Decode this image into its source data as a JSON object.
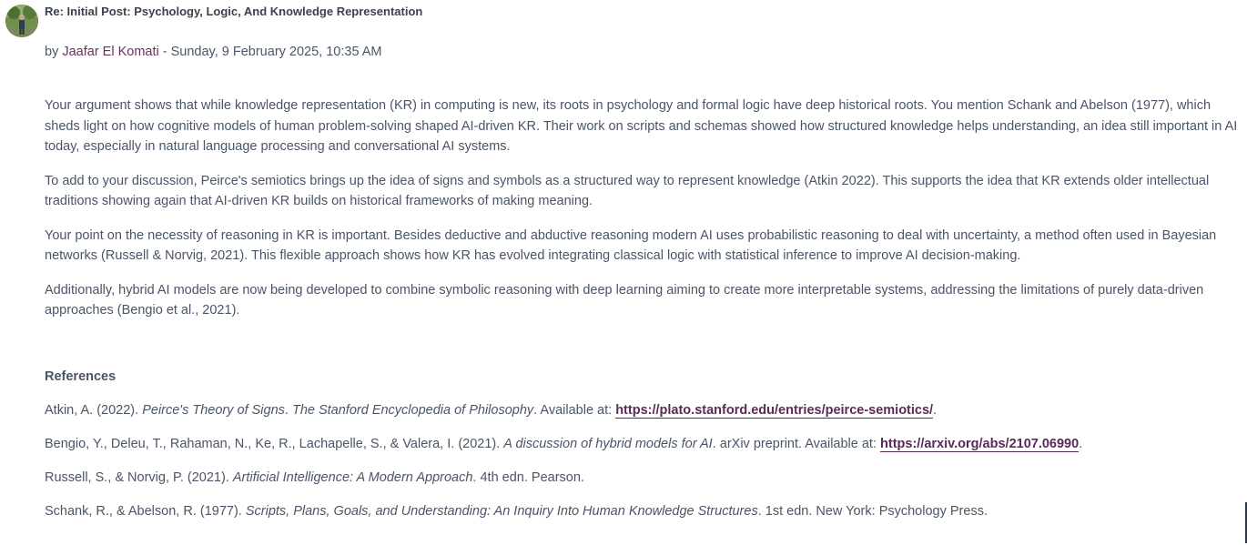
{
  "post": {
    "subject": "Re: Initial Post: Psychology, Logic, And Knowledge Representation",
    "by_prefix": "by ",
    "author": "Jaafar El Komati",
    "date": " - Sunday, 9 February 2025, 10:35 AM",
    "paragraphs": [
      "Your argument shows that while knowledge representation (KR) in computing is new, its roots in psychology and formal logic have deep historical roots. You mention Schank and Abelson (1977), which sheds light on how cognitive models of human problem-solving shaped AI-driven KR. Their work on scripts and schemas showed how structured knowledge helps understanding, an idea still important in AI today, especially in natural language processing and conversational AI systems.",
      "To add to your discussion, Peirce's semiotics brings up the idea of signs and symbols as a structured way to represent knowledge (Atkin 2022). This supports the idea that KR extends older intellectual traditions showing again that AI-driven KR builds on historical frameworks of making meaning.",
      "Your point on the necessity of reasoning in KR is important. Besides deductive and abductive reasoning modern AI uses probabilistic reasoning to deal with uncertainty, a method often used in Bayesian networks (Russell & Norvig, 2021). This flexible approach shows how KR has evolved integrating classical logic with statistical inference to improve AI decision-making.",
      "Additionally, hybrid AI models are now being developed to combine symbolic reasoning with deep learning aiming to create more interpretable systems, addressing the limitations of purely data-driven approaches (Bengio et al., 2021)."
    ],
    "references_heading": "References",
    "references": [
      {
        "before": "Atkin, A. (2022). ",
        "title": "Peirce's Theory of Signs",
        "mid": ". ",
        "source": "The Stanford Encyclopedia of Philosophy",
        "after": ". Available at: ",
        "link": "https://plato.stanford.edu/entries/peirce-semiotics/",
        "end": "."
      },
      {
        "before": "Bengio, Y., Deleu, T., Rahaman, N., Ke, R., Lachapelle, S., & Valera, I. (2021). ",
        "title": "A discussion of hybrid models for AI",
        "after": ". arXiv preprint. Available at: ",
        "link": "https://arxiv.org/abs/2107.06990",
        "end": "."
      },
      {
        "before": "Russell, S., & Norvig, P. (2021). ",
        "title": "Artificial Intelligence: A Modern Approach",
        "after": ". 4th edn. Pearson."
      },
      {
        "before": "Schank, R., & Abelson, R. (1977). ",
        "title": "Scripts, Plans, Goals, and Understanding: An Inquiry Into Human Knowledge Structures",
        "after": ". 1st edn. New York: Psychology Press."
      }
    ]
  },
  "colors": {
    "text": "#4a5568",
    "author_link": "#6a2f64",
    "url_link": "#5b2a56"
  }
}
